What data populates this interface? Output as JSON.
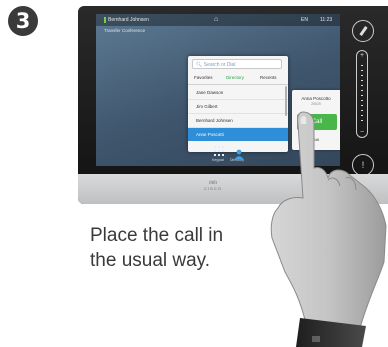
{
  "step": {
    "number": "3"
  },
  "screen": {
    "user_name": "Bernhard Johnsen",
    "home_glyph": "⌂",
    "status_indicator": "EN",
    "time": "11:23",
    "subtitle": "Transfer Conference"
  },
  "dialog": {
    "search_placeholder": "Search or Dial",
    "tabs": [
      {
        "label": "Favorites",
        "active": false
      },
      {
        "label": "Directory",
        "active": true
      },
      {
        "label": "Recents",
        "active": false
      }
    ],
    "entries": [
      "Jane Dawson",
      "Jim Gilbert",
      "Bernhard Johnsen",
      "Anne Poscotti"
    ],
    "selected_entry": "Anne Poscotti"
  },
  "card": {
    "name": "Anna Poscotto",
    "number": "20020",
    "call_label": "Call",
    "edit_label": "Edit"
  },
  "bottom_icons": {
    "keypad_label": "Keypad",
    "contacts_label": "Directory"
  },
  "right_panel": {
    "vol_plus": "+",
    "vol_minus": "−",
    "help": "!"
  },
  "brand": {
    "logo_bars": "ılıılı",
    "logo_text": "CISCO"
  },
  "caption": {
    "text": "Place the call in the usual way."
  },
  "colors": {
    "call_green": "#49b649",
    "selected_blue": "#2f8ed8",
    "active_tab": "#2aa24a"
  }
}
